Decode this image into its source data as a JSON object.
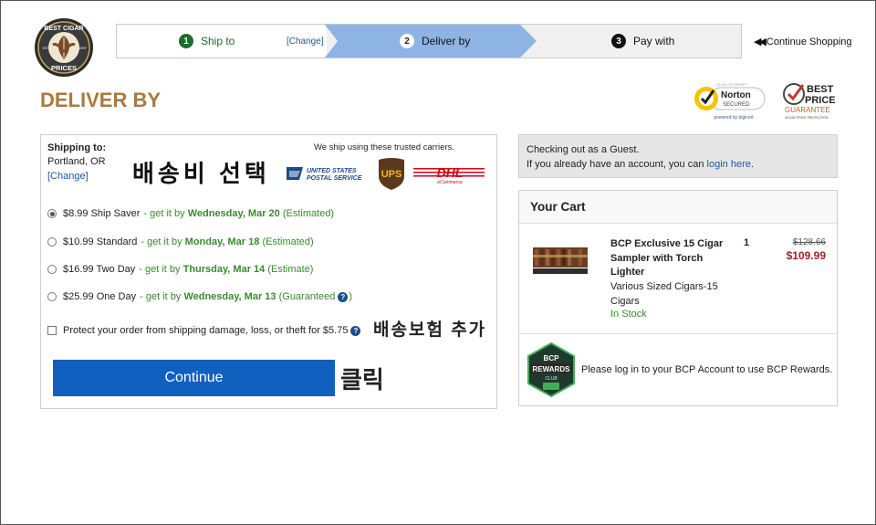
{
  "logo": {
    "name": "Best Cigar Prices",
    "top": "BEST CIGAR",
    "bottom": "PRICES",
    "est": "EST.",
    "year": "1997"
  },
  "steps": [
    {
      "num": "1",
      "label": "Ship to",
      "change": "[Change]"
    },
    {
      "num": "2",
      "label": "Deliver by"
    },
    {
      "num": "3",
      "label": "Pay with"
    }
  ],
  "continue_shopping": "Continue Shopping",
  "page_title": "DELIVER BY",
  "badges": {
    "norton_top": "CLICK TO VERIFY",
    "norton_brand": "Norton",
    "norton_sub": "SECURED",
    "norton_footer": "powered by digicert",
    "best_price_1": "BEST",
    "best_price_2": "PRICE",
    "best_price_3": "GUARANTEE",
    "best_price_4": "30-DAY PRICE PROTECTION"
  },
  "shipping": {
    "label": "Shipping to:",
    "city": "Portland, OR",
    "change": "[Change]",
    "carriers_note": "We ship using these trusted carriers.",
    "carriers": {
      "usps_1": "UNITED STATES",
      "usps_2": "POSTAL SERVICE",
      "ups": "UPS",
      "dhl": "DHL",
      "dhl_sub": "eCommerce"
    },
    "options": [
      {
        "price": "$8.99 Ship Saver",
        "pre": "- get it by",
        "date": "Wednesday, Mar 20",
        "post": "(Estimated)",
        "selected": true
      },
      {
        "price": "$10.99 Standard",
        "pre": "- get it by",
        "date": "Monday, Mar 18",
        "post": "(Estimated)",
        "selected": false
      },
      {
        "price": "$16.99 Two Day",
        "pre": "- get it by",
        "date": "Thursday, Mar 14",
        "post": "(Estimate)",
        "selected": false
      },
      {
        "price": "$25.99 One Day",
        "pre": "- get it by",
        "date": "Wednesday, Mar 13",
        "post": "(Guaranteed",
        "post2": ")",
        "selected": false
      }
    ],
    "protect": "Protect your order from shipping damage, loss, or theft for $5.75",
    "continue_label": "Continue"
  },
  "annotations": {
    "select_shipping": "배송비 선택",
    "add_insurance": "배송보험 추가",
    "click": "클릭"
  },
  "guest": {
    "line1": "Checking out as a Guest.",
    "line2_pre": "If you already have an account, you can",
    "login": "login here",
    "line2_post": "."
  },
  "cart": {
    "title": "Your Cart",
    "item": {
      "name": "BCP Exclusive 15 Cigar Sampler with Torch Lighter",
      "desc": "Various Sized Cigars-15 Cigars",
      "stock": "In Stock",
      "qty": "1",
      "old_price": "$128.66",
      "price": "$109.99"
    },
    "rewards_top": "BCP",
    "rewards_mid": "REWARDS",
    "rewards_bottom": "CLUB",
    "rewards_msg": "Please log in to your BCP Account to use BCP Rewards."
  },
  "colors": {
    "accent_blue": "#1060c0",
    "step_active": "#8db4e2",
    "green": "#3a8a2e",
    "title_brown": "#a87a3c",
    "price_red": "#a0212a"
  }
}
